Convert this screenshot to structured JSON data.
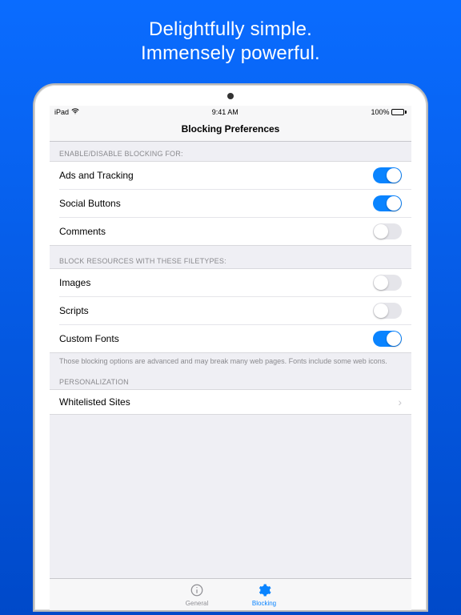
{
  "marketing": {
    "line1": "Delightfully simple.",
    "line2": "Immensely powerful."
  },
  "status_bar": {
    "device": "iPad",
    "time": "9:41 AM",
    "battery_pct": "100%"
  },
  "nav": {
    "title": "Blocking Preferences"
  },
  "sections": {
    "blocking": {
      "header": "ENABLE/DISABLE BLOCKING FOR:",
      "items": [
        {
          "label": "Ads and Tracking",
          "on": true
        },
        {
          "label": "Social Buttons",
          "on": true
        },
        {
          "label": "Comments",
          "on": false
        }
      ]
    },
    "filetypes": {
      "header": "BLOCK RESOURCES WITH THESE FILETYPES:",
      "items": [
        {
          "label": "Images",
          "on": false
        },
        {
          "label": "Scripts",
          "on": false
        },
        {
          "label": "Custom Fonts",
          "on": true
        }
      ],
      "footer": "Those blocking options are advanced and may break many web pages. Fonts include some web icons."
    },
    "personalization": {
      "header": "PERSONALIZATION",
      "items": [
        {
          "label": "Whitelisted Sites"
        }
      ]
    }
  },
  "tabs": {
    "general": "General",
    "blocking": "Blocking"
  }
}
